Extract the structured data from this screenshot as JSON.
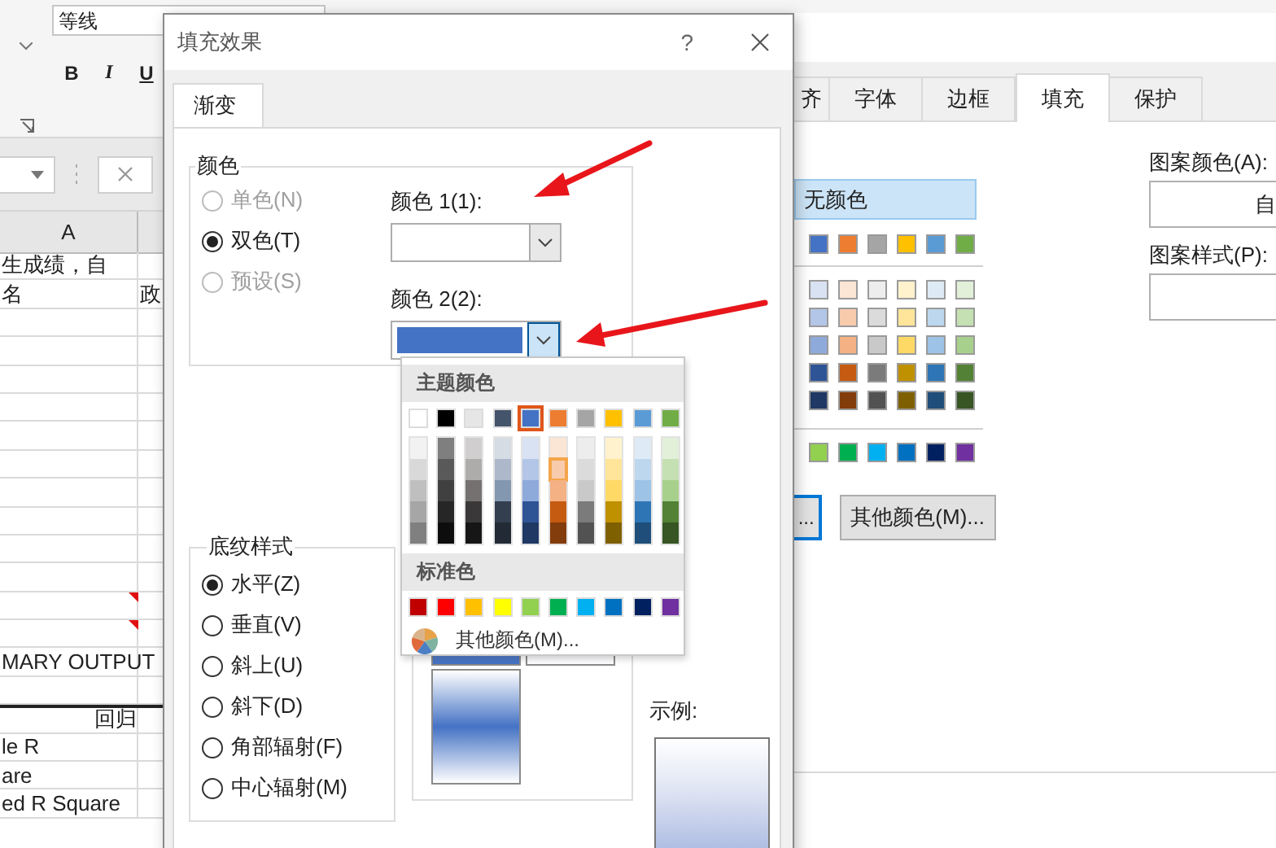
{
  "ribbon": {
    "font_name": "等线",
    "font_styles": [
      "B",
      "I",
      "U"
    ]
  },
  "sheet": {
    "column_header": "A",
    "rows": [
      {
        "a": "生成绩，自",
        "comment": false
      },
      {
        "a": "名",
        "b": "政",
        "comment": false
      },
      {
        "comment": false
      },
      {
        "comment": false
      },
      {
        "comment": false
      },
      {
        "comment": false
      },
      {
        "comment": false
      },
      {
        "comment": false
      },
      {
        "comment": false
      },
      {
        "comment": false
      },
      {
        "comment": false
      },
      {
        "comment": false
      },
      {
        "comment": true
      },
      {
        "comment": true
      },
      {
        "a": "MARY OUTPUT",
        "comment": false
      },
      {
        "comment": false
      },
      {
        "a": "回归",
        "kind": "heading",
        "comment": false
      },
      {
        "a": "le R",
        "comment": false
      },
      {
        "a": "are",
        "comment": false
      },
      {
        "a": "ed R Square",
        "comment": false
      }
    ]
  },
  "format_dialog": {
    "tabs": [
      {
        "label": "齐",
        "selected": false
      },
      {
        "label": "字体",
        "selected": false
      },
      {
        "label": "边框",
        "selected": false
      },
      {
        "label": "填充",
        "selected": true
      },
      {
        "label": "保护",
        "selected": false
      }
    ],
    "no_color_button": "无颜色",
    "theme_colors": [
      {
        "color": "#4472c4"
      },
      {
        "color": "#ed7d31"
      },
      {
        "color": "#a5a5a5"
      },
      {
        "color": "#ffc000"
      },
      {
        "color": "#5b9bd5"
      },
      {
        "color": "#70ad47"
      }
    ],
    "shade_rows": [
      {
        "colors": [
          {
            "color": "#d9e2f3"
          },
          {
            "color": "#fbe5d5"
          },
          {
            "color": "#ededed"
          },
          {
            "color": "#fff2cc"
          },
          {
            "color": "#deebf6"
          },
          {
            "color": "#e2efd9"
          }
        ]
      },
      {
        "colors": [
          {
            "color": "#b4c6e7"
          },
          {
            "color": "#f8cbad"
          },
          {
            "color": "#dbdbdb"
          },
          {
            "color": "#fee599"
          },
          {
            "color": "#bdd7ee"
          },
          {
            "color": "#c5e0b3"
          }
        ]
      },
      {
        "colors": [
          {
            "color": "#8eaadb"
          },
          {
            "color": "#f4b183"
          },
          {
            "color": "#c9c9c9"
          },
          {
            "color": "#ffd966"
          },
          {
            "color": "#9dc3e6"
          },
          {
            "color": "#a8d08d"
          }
        ]
      },
      {
        "colors": [
          {
            "color": "#2f5496"
          },
          {
            "color": "#c55a11"
          },
          {
            "color": "#7b7b7b"
          },
          {
            "color": "#bf9000"
          },
          {
            "color": "#2e75b5"
          },
          {
            "color": "#538135"
          }
        ]
      },
      {
        "colors": [
          {
            "color": "#1f3864"
          },
          {
            "color": "#833c0b"
          },
          {
            "color": "#525252"
          },
          {
            "color": "#7f6000"
          },
          {
            "color": "#1e4e79"
          },
          {
            "color": "#375623"
          }
        ]
      }
    ],
    "standard_colors": [
      {
        "color": "#92d050"
      },
      {
        "color": "#00b050"
      },
      {
        "color": "#00b0f0"
      },
      {
        "color": "#0070c0"
      },
      {
        "color": "#002060"
      },
      {
        "color": "#7030a0"
      }
    ],
    "fill_effects_button": "...",
    "more_colors_button": "其他颜色(M)...",
    "pattern_color_label": "图案颜色(A):",
    "pattern_color_value": "自",
    "pattern_style_label": "图案样式(P):"
  },
  "fill_dialog": {
    "title": "填充效果",
    "help": "?",
    "tabs": [
      {
        "label": "渐变",
        "selected": true
      }
    ],
    "colors_group": {
      "legend": "颜色",
      "options": [
        {
          "label": "单色(N)",
          "selected": false,
          "disabled": true
        },
        {
          "label": "双色(T)",
          "selected": true,
          "disabled": false
        },
        {
          "label": "预设(S)",
          "selected": false,
          "disabled": true
        }
      ],
      "color1": {
        "label": "颜色 1(1):",
        "open": false
      },
      "color2": {
        "label": "颜色 2(2):",
        "color": "#4472c4",
        "open": true
      }
    },
    "shading_group": {
      "legend": "底纹样式",
      "options": [
        {
          "label": "水平(Z)",
          "selected": true
        },
        {
          "label": "垂直(V)",
          "selected": false
        },
        {
          "label": "斜上(U)",
          "selected": false
        },
        {
          "label": "斜下(D)",
          "selected": false
        },
        {
          "label": "角部辐射(F)",
          "selected": false
        },
        {
          "label": "中心辐射(M)",
          "selected": false
        }
      ]
    },
    "sample_label": "示例:",
    "color_menu": {
      "theme_heading": "主题颜色",
      "theme_colors": [
        {
          "color": "#ffffff",
          "selected": false
        },
        {
          "color": "#000000",
          "selected": false
        },
        {
          "color": "#e7e6e6",
          "selected": false
        },
        {
          "color": "#44546a",
          "selected": false
        },
        {
          "color": "#4472c4",
          "selected": true
        },
        {
          "color": "#ed7d31",
          "selected": false
        },
        {
          "color": "#a5a5a5",
          "selected": false
        },
        {
          "color": "#ffc000",
          "selected": false
        },
        {
          "color": "#5b9bd5",
          "selected": false
        },
        {
          "color": "#70ad47",
          "selected": false
        }
      ],
      "theme_shades": [
        {
          "shades": [
            {
              "color": "#f2f2f2",
              "selected": false
            },
            {
              "color": "#d9d9d9",
              "selected": false
            },
            {
              "color": "#bfbfbf",
              "selected": false
            },
            {
              "color": "#a6a6a6",
              "selected": false
            },
            {
              "color": "#808080",
              "selected": false
            }
          ]
        },
        {
          "shades": [
            {
              "color": "#7f7f7f",
              "selected": false
            },
            {
              "color": "#595959",
              "selected": false
            },
            {
              "color": "#404040",
              "selected": false
            },
            {
              "color": "#262626",
              "selected": false
            },
            {
              "color": "#0d0d0d",
              "selected": false
            }
          ]
        },
        {
          "shades": [
            {
              "color": "#d0cece",
              "selected": false
            },
            {
              "color": "#aeabab",
              "selected": false
            },
            {
              "color": "#757171",
              "selected": false
            },
            {
              "color": "#3a3838",
              "selected": false
            },
            {
              "color": "#171616",
              "selected": false
            }
          ]
        },
        {
          "shades": [
            {
              "color": "#d6dce4",
              "selected": false
            },
            {
              "color": "#adb9ca",
              "selected": false
            },
            {
              "color": "#8497b0",
              "selected": false
            },
            {
              "color": "#333f4f",
              "selected": false
            },
            {
              "color": "#222a35",
              "selected": false
            }
          ]
        },
        {
          "shades": [
            {
              "color": "#d9e2f3",
              "selected": false
            },
            {
              "color": "#b4c6e7",
              "selected": false
            },
            {
              "color": "#8eaadb",
              "selected": false
            },
            {
              "color": "#2f5496",
              "selected": false
            },
            {
              "color": "#1f3864",
              "selected": false
            }
          ]
        },
        {
          "shades": [
            {
              "color": "#fbe5d5",
              "selected": false
            },
            {
              "color": "#f8cbad",
              "selected": true
            },
            {
              "color": "#f4b183",
              "selected": false
            },
            {
              "color": "#c55a11",
              "selected": false
            },
            {
              "color": "#833c0b",
              "selected": false
            }
          ]
        },
        {
          "shades": [
            {
              "color": "#ededed",
              "selected": false
            },
            {
              "color": "#dbdbdb",
              "selected": false
            },
            {
              "color": "#c9c9c9",
              "selected": false
            },
            {
              "color": "#7b7b7b",
              "selected": false
            },
            {
              "color": "#525252",
              "selected": false
            }
          ]
        },
        {
          "shades": [
            {
              "color": "#fff2cc",
              "selected": false
            },
            {
              "color": "#fee599",
              "selected": false
            },
            {
              "color": "#ffd966",
              "selected": false
            },
            {
              "color": "#bf9000",
              "selected": false
            },
            {
              "color": "#7f6000",
              "selected": false
            }
          ]
        },
        {
          "shades": [
            {
              "color": "#deebf6",
              "selected": false
            },
            {
              "color": "#bdd7ee",
              "selected": false
            },
            {
              "color": "#9dc3e6",
              "selected": false
            },
            {
              "color": "#2e75b5",
              "selected": false
            },
            {
              "color": "#1e4e79",
              "selected": false
            }
          ]
        },
        {
          "shades": [
            {
              "color": "#e2efd9",
              "selected": false
            },
            {
              "color": "#c5e0b3",
              "selected": false
            },
            {
              "color": "#a8d08d",
              "selected": false
            },
            {
              "color": "#538135",
              "selected": false
            },
            {
              "color": "#375623",
              "selected": false
            }
          ]
        }
      ],
      "standard_heading": "标准色",
      "standard_colors": [
        {
          "color": "#c00000",
          "selected": false
        },
        {
          "color": "#ff0000",
          "selected": false
        },
        {
          "color": "#ffc000",
          "selected": false
        },
        {
          "color": "#ffff00",
          "selected": false
        },
        {
          "color": "#92d050",
          "selected": false
        },
        {
          "color": "#00b050",
          "selected": false
        },
        {
          "color": "#00b0f0",
          "selected": false
        },
        {
          "color": "#0070c0",
          "selected": false
        },
        {
          "color": "#002060",
          "selected": false
        },
        {
          "color": "#7030a0",
          "selected": false
        }
      ],
      "more_colors": "其他颜色(M)..."
    }
  }
}
